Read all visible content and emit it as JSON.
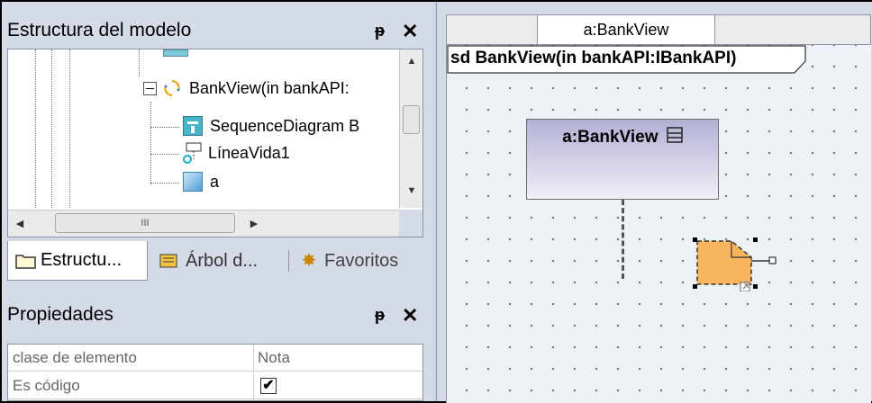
{
  "model_panel": {
    "title": "Estructura del modelo",
    "pin": "ᵽ",
    "close": "✕",
    "tree": {
      "items": [
        {
          "label": "BankView(in bankAPI:",
          "icon": "interaction-icon"
        },
        {
          "label": "SequenceDiagram B",
          "icon": "sequence-diagram-icon"
        },
        {
          "label": "LíneaVida1",
          "icon": "lifeline-icon"
        },
        {
          "label": "a",
          "icon": "note-icon"
        }
      ],
      "hscroll_mark": "III"
    },
    "tabs": [
      {
        "label": "Estructu...",
        "icon": "folder-icon",
        "active": true
      },
      {
        "label": "Árbol d...",
        "icon": "tree-icon",
        "active": false
      },
      {
        "label": "Favoritos",
        "icon": "favorites-icon",
        "active": false
      }
    ]
  },
  "properties_panel": {
    "title": "Propiedades",
    "pin": "ᵽ",
    "close": "✕",
    "rows": [
      {
        "name": "clase de elemento",
        "value": "Nota"
      },
      {
        "name": "Es código",
        "value": "✔"
      }
    ]
  },
  "diagram": {
    "tab_label": "a:BankView",
    "frame_label": "sd BankView(in bankAPI:IBankAPI)",
    "lifeline_label": "a:BankView",
    "note": {
      "fill_color": "#f9b55e",
      "selected": true
    }
  }
}
